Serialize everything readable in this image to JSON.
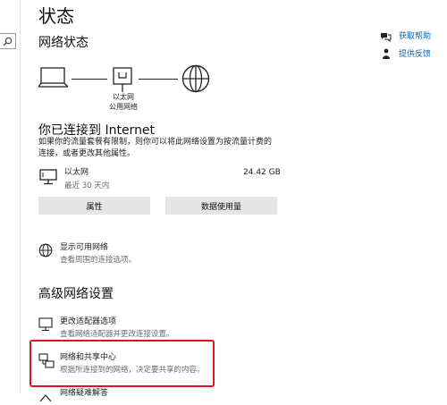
{
  "page": {
    "title": "状态"
  },
  "network_status": {
    "heading": "网络状态",
    "adapter_label_line1": "以太网",
    "adapter_label_line2": "公用网络"
  },
  "connection": {
    "title": "你已连接到 Internet",
    "description_line1": "如果你的流量套餐有限制，则你可以将此网络设置为按流量计费的",
    "description_line2": "连接，或者更改其他属性。",
    "adapter_name": "以太网",
    "adapter_time": "最近 30 天内",
    "data_usage": "24.42 GB",
    "properties_button": "属性",
    "data_usage_button": "数据使用量"
  },
  "show_networks": {
    "title": "显示可用网络",
    "subtitle": "查看周围的连接选项。"
  },
  "advanced": {
    "heading": "高级网络设置",
    "items": [
      {
        "title": "更改适配器选项",
        "subtitle": "查看网络适配器并更改连接设置。"
      },
      {
        "title": "网络和共享中心",
        "subtitle": "根据所连接到的网络，决定要共享的内容。"
      },
      {
        "title": "网络疑难解答",
        "subtitle": ""
      }
    ]
  },
  "help": {
    "get_help": "获取帮助",
    "feedback": "提供反馈"
  },
  "colors": {
    "accent": "#0a63b5",
    "highlight_border": "#e0141e",
    "button_bg": "#e5e5e5"
  },
  "icons": [
    "search-icon",
    "laptop-icon",
    "ethernet-icon",
    "globe-icon",
    "desktop-icon",
    "available-networks-icon",
    "adapter-options-icon",
    "sharing-center-icon",
    "troubleshoot-icon",
    "help-icon",
    "feedback-icon"
  ]
}
